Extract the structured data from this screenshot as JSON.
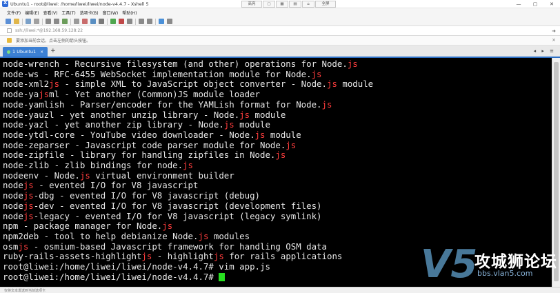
{
  "window": {
    "title": "Ubuntu1 - root@liwei: /home/liwei/liwei/node-v4.4.7 - Xshell 5",
    "center_buttons": [
      "高亮",
      "",
      "",
      "",
      "",
      "全屏"
    ],
    "controls": [
      "—",
      "▢",
      "✕"
    ]
  },
  "menu": {
    "items": [
      "文件(F)",
      "编辑(E)",
      "查看(V)",
      "工具(T)",
      "选项卡(B)",
      "窗口(W)",
      "帮助(H)"
    ]
  },
  "address": {
    "text": "ssh://liwei:*@192.168.59.128:22"
  },
  "hint": {
    "text": "要添加当前会话，点击左侧的箭头按钮。"
  },
  "tab": {
    "label": "1 Ubuntu1",
    "close": "×",
    "add": "+",
    "nav": "◂ ▸ ≡"
  },
  "terminal": {
    "lines": [
      [
        {
          "t": "node-wrench - Recursive filesystem (and other) operations for Node."
        },
        {
          "t": "js",
          "h": true
        }
      ],
      [
        {
          "t": "node-ws - RFC-6455 WebSocket implementation module for Node."
        },
        {
          "t": "js",
          "h": true
        }
      ],
      [
        {
          "t": "node-xml2"
        },
        {
          "t": "js",
          "h": true
        },
        {
          "t": " - simple XML to JavaScript object converter - Node."
        },
        {
          "t": "js",
          "h": true
        },
        {
          "t": " module"
        }
      ],
      [
        {
          "t": "node-ya"
        },
        {
          "t": "js",
          "h": true
        },
        {
          "t": "ml - Yet another (Common)JS module loader"
        }
      ],
      [
        {
          "t": "node-yamlish - Parser/encoder for the YAMLish format for Node."
        },
        {
          "t": "js",
          "h": true
        }
      ],
      [
        {
          "t": "node-yauzl - yet another unzip library - Node."
        },
        {
          "t": "js",
          "h": true
        },
        {
          "t": " module"
        }
      ],
      [
        {
          "t": "node-yazl - yet another zip library - Node."
        },
        {
          "t": "js",
          "h": true
        },
        {
          "t": " module"
        }
      ],
      [
        {
          "t": "node-ytdl-core - YouTube video downloader - Node."
        },
        {
          "t": "js",
          "h": true
        },
        {
          "t": " module"
        }
      ],
      [
        {
          "t": "node-zeparser - Javascript code parser module for Node."
        },
        {
          "t": "js",
          "h": true
        }
      ],
      [
        {
          "t": "node-zipfile - library for handling zipfiles in Node."
        },
        {
          "t": "js",
          "h": true
        }
      ],
      [
        {
          "t": "node-zlib - zlib bindings for node."
        },
        {
          "t": "js",
          "h": true
        }
      ],
      [
        {
          "t": "nodeenv - Node."
        },
        {
          "t": "js",
          "h": true
        },
        {
          "t": " virtual environment builder"
        }
      ],
      [
        {
          "t": "node"
        },
        {
          "t": "js",
          "h": true
        },
        {
          "t": " - evented I/O for V8 javascript"
        }
      ],
      [
        {
          "t": "node"
        },
        {
          "t": "js",
          "h": true
        },
        {
          "t": "-dbg - evented I/O for V8 javascript (debug)"
        }
      ],
      [
        {
          "t": "node"
        },
        {
          "t": "js",
          "h": true
        },
        {
          "t": "-dev - evented I/O for V8 javascript (development files)"
        }
      ],
      [
        {
          "t": "node"
        },
        {
          "t": "js",
          "h": true
        },
        {
          "t": "-legacy - evented I/O for V8 javascript (legacy symlink)"
        }
      ],
      [
        {
          "t": "npm - package manager for Node."
        },
        {
          "t": "js",
          "h": true
        }
      ],
      [
        {
          "t": "npm2deb - tool to help debianize Node."
        },
        {
          "t": "js",
          "h": true
        },
        {
          "t": " modules"
        }
      ],
      [
        {
          "t": "osm"
        },
        {
          "t": "js",
          "h": true
        },
        {
          "t": " - osmium-based Javascript framework for handling OSM data"
        }
      ],
      [
        {
          "t": "ruby-rails-assets-highlight"
        },
        {
          "t": "js",
          "h": true
        },
        {
          "t": " - highlight"
        },
        {
          "t": "js",
          "h": true
        },
        {
          "t": " for rails applications"
        }
      ],
      [
        {
          "t": "root@liwei:/home/liwei/liwei/node-v4.4.7# vim app.js"
        }
      ]
    ],
    "prompt": "root@liwei:/home/liwei/liwei/node-v4.4.7# "
  },
  "watermark": {
    "logo": "V5",
    "title": "攻城狮论坛",
    "url": "bbs.vlan5.com"
  },
  "status": {
    "text": "仅将文本发送到当前选项卡"
  },
  "colors": {
    "terminal_bg": "#000000",
    "terminal_fg": "#e8e8e8",
    "highlight": "#ff3d3d",
    "cursor": "#27e020",
    "tab_active": "#3c80d4"
  }
}
